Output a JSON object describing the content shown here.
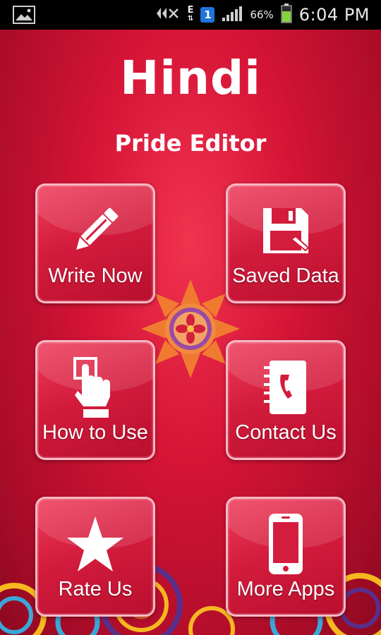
{
  "status_bar": {
    "network_label": "E",
    "badge": "1",
    "battery": "66%",
    "time": "6:04 PM"
  },
  "app": {
    "title": "Hindi",
    "subtitle": "Pride Editor"
  },
  "menu": [
    {
      "label": "Write Now",
      "icon": "pencil-icon"
    },
    {
      "label": "Saved Data",
      "icon": "floppy-disk-icon"
    },
    {
      "label": "How to Use",
      "icon": "touch-hand-icon"
    },
    {
      "label": "Contact Us",
      "icon": "address-book-icon"
    },
    {
      "label": "Rate Us",
      "icon": "star-icon"
    },
    {
      "label": "More Apps",
      "icon": "smartphone-icon"
    }
  ],
  "colors": {
    "background": "#d51436",
    "tile": "#d41c3d",
    "accent_flower": "#f07a30"
  }
}
